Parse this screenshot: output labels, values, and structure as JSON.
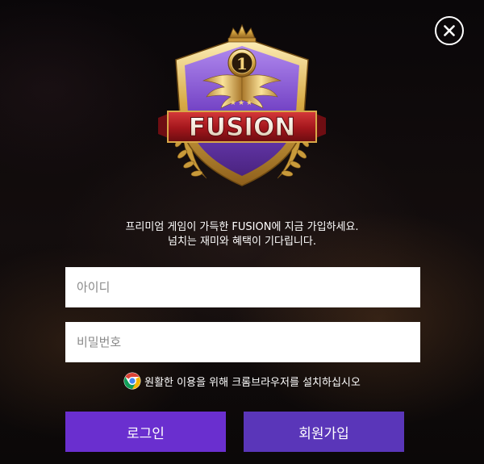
{
  "modal": {
    "close_icon": "close-icon",
    "logo": {
      "text": "FUSION",
      "rank": "1",
      "colors": {
        "shield": "#6d3fb3",
        "gold": "#d7aa45",
        "ribbon": "#a3161c"
      }
    },
    "tagline": {
      "line1": "프리미엄 게임이 가득한 FUSION에 지금 가입하세요.",
      "line2": "넘치는 재미와 혜택이 기다립니다."
    },
    "username_field": {
      "placeholder": "아이디",
      "value": ""
    },
    "password_field": {
      "placeholder": "비밀번호",
      "value": ""
    },
    "browser_notice": {
      "icon": "chrome-icon",
      "text": "원활한 이용을 위해 크롬브라우저를 설치하십시오"
    },
    "buttons": {
      "login_label": "로그인",
      "signup_label": "회원가입"
    },
    "colors": {
      "login_button": "#6a2fcf",
      "signup_button": "#5a36b9",
      "background": "#0b0809"
    }
  }
}
